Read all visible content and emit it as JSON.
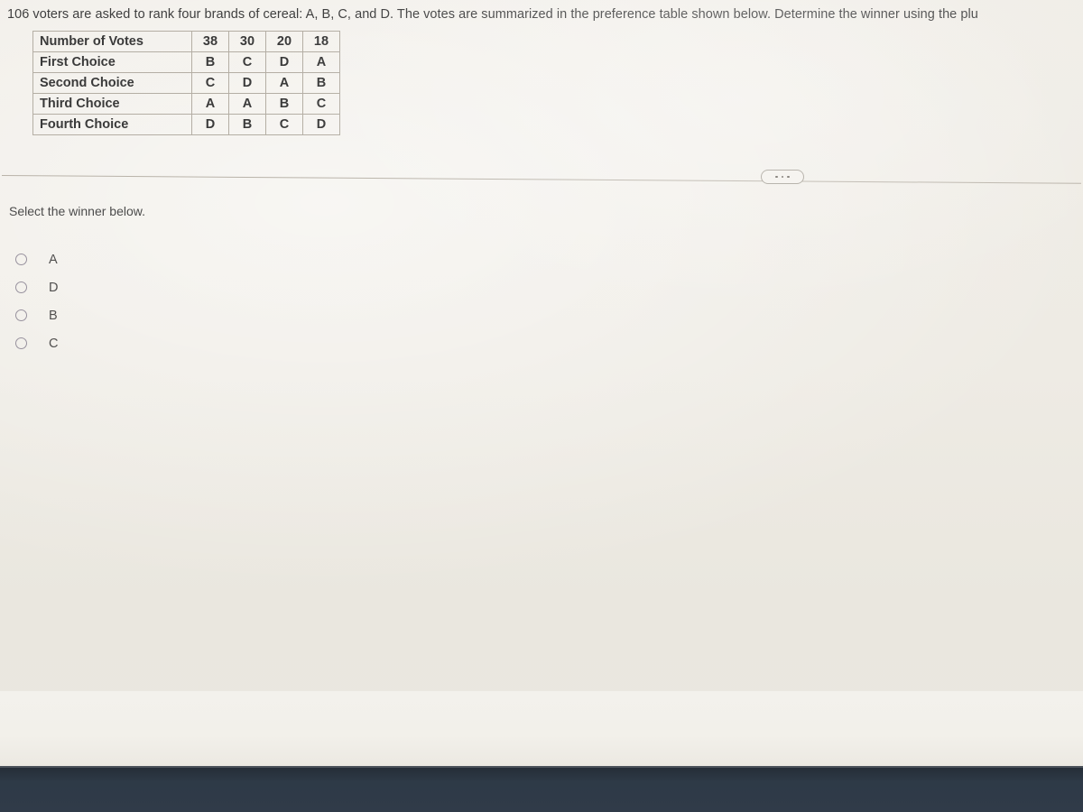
{
  "question": {
    "text": "106 voters are asked to rank four brands of cereal: A, B, C, and D. The votes are summarized in the preference table shown below. Determine the winner using the plu"
  },
  "preference_table": {
    "rows": [
      {
        "label": "Number of Votes",
        "cells": [
          "38",
          "30",
          "20",
          "18"
        ]
      },
      {
        "label": "First Choice",
        "cells": [
          "B",
          "C",
          "D",
          "A"
        ]
      },
      {
        "label": "Second Choice",
        "cells": [
          "C",
          "D",
          "A",
          "B"
        ]
      },
      {
        "label": "Third Choice",
        "cells": [
          "A",
          "A",
          "B",
          "C"
        ]
      },
      {
        "label": "Fourth Choice",
        "cells": [
          "D",
          "B",
          "C",
          "D"
        ]
      }
    ]
  },
  "divider": {
    "more_button_label": "•••"
  },
  "prompt": {
    "label": "Select the winner below."
  },
  "winner_options": [
    {
      "label": "A",
      "selected": false
    },
    {
      "label": "D",
      "selected": false
    },
    {
      "label": "B",
      "selected": false
    },
    {
      "label": "C",
      "selected": false
    }
  ],
  "colors": {
    "page_background": "#efece6",
    "text": "#4a4a4a",
    "table_border": "#b4aea4",
    "divider_line": "#b9b3a9",
    "radio_border": "#98929e",
    "bottom_band": "#2e3a47"
  }
}
